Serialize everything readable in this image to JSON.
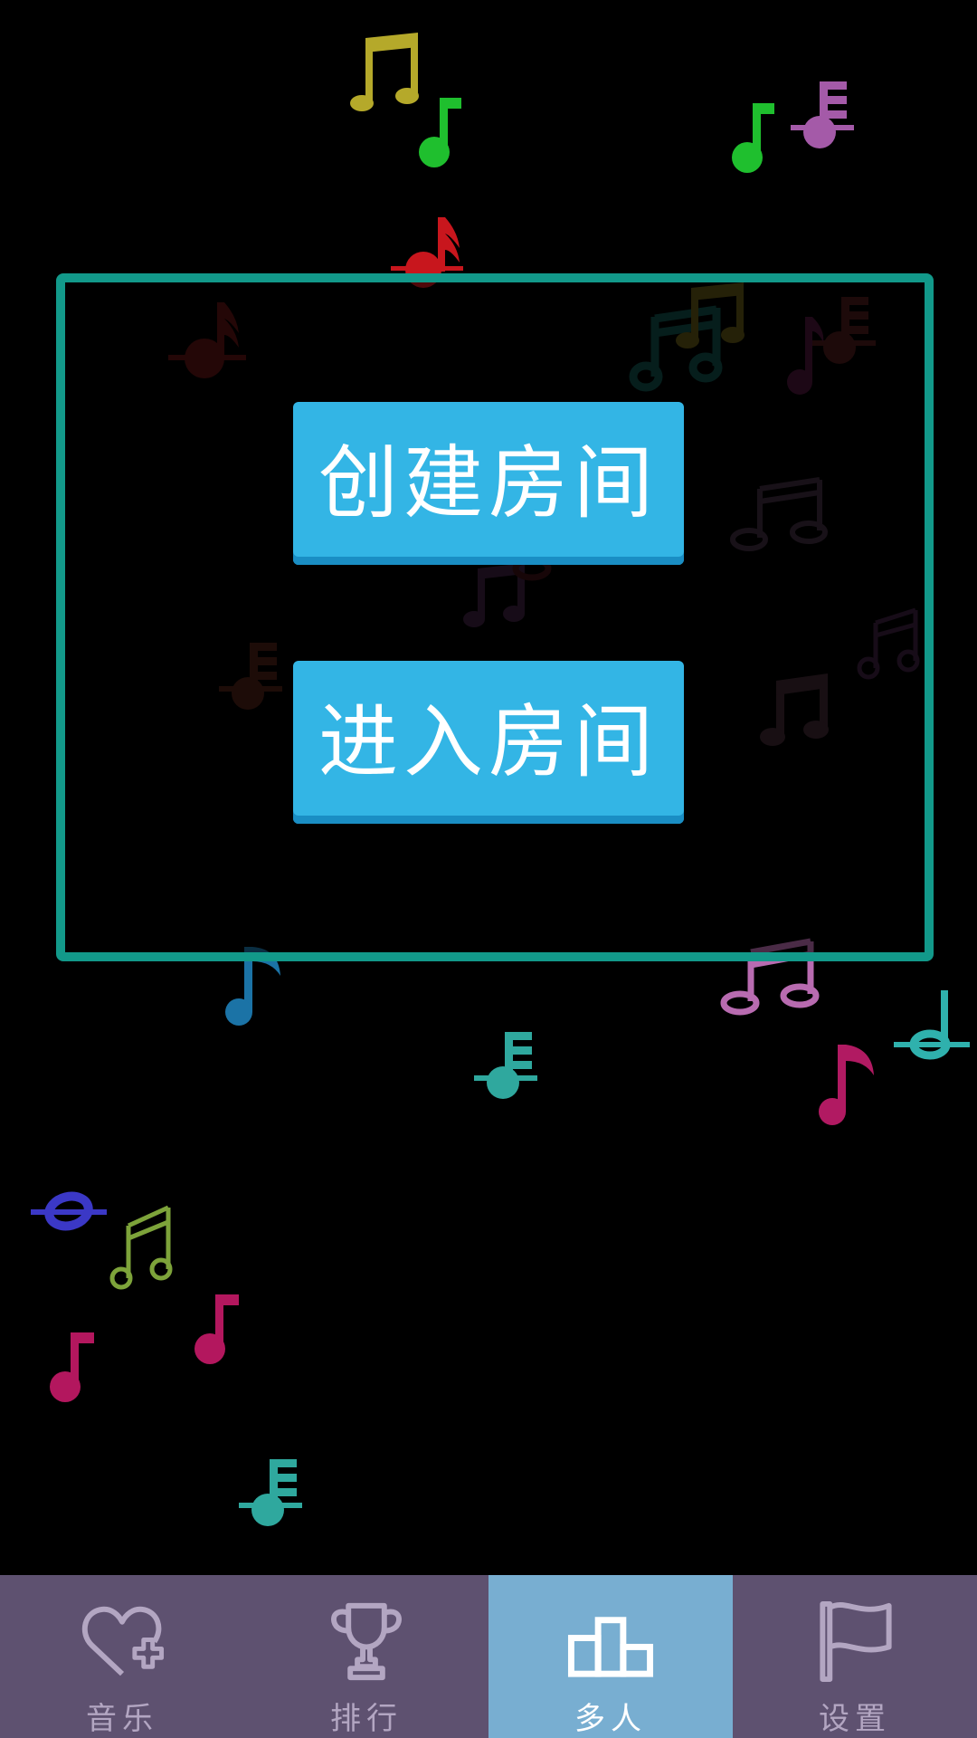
{
  "colors": {
    "background": "#000000",
    "dialog_border": "#12998a",
    "button_fill": "#33b5e5",
    "tabbar_bg": "#5e5170",
    "tab_active_bg": "#78aed1",
    "tab_inactive_text": "#b3a6c2",
    "tab_active_text": "#ffffff"
  },
  "dialog": {
    "create_room_label": "创建房间",
    "enter_room_label": "进入房间"
  },
  "tabbar": {
    "selected_tab": "多人",
    "tabs": [
      {
        "label": "音乐",
        "icon": "heart-plus-icon",
        "active": false
      },
      {
        "label": "排行",
        "icon": "trophy-icon",
        "active": false
      },
      {
        "label": "多人",
        "icon": "podium-icon",
        "active": true
      },
      {
        "label": "设置",
        "icon": "flag-icon",
        "active": false
      }
    ]
  },
  "background_notes": [
    {
      "icon": "beamed-eighth-notes-icon",
      "color": "#b5a92a"
    },
    {
      "icon": "eighth-note-icon",
      "color": "#1fbf2e"
    },
    {
      "icon": "eighth-note-icon",
      "color": "#1fbf2e"
    },
    {
      "icon": "thirty-second-note-icon",
      "color": "#a45aa8"
    },
    {
      "icon": "sixty-fourth-note-icon",
      "color": "#c8161d"
    },
    {
      "icon": "sixty-fourth-note-icon",
      "color": "#5a1212"
    },
    {
      "icon": "beamed-eighth-notes-icon",
      "color": "#0f4d48"
    },
    {
      "icon": "beamed-eighth-notes-icon",
      "color": "#5e5314"
    },
    {
      "icon": "thirty-second-note-icon",
      "color": "#4a1a1a"
    },
    {
      "icon": "eighth-note-icon",
      "color": "#4a1538"
    },
    {
      "icon": "beamed-eighth-notes-icon",
      "color": "#3d2b3d"
    },
    {
      "icon": "beamed-eighth-notes-icon",
      "color": "#3a1f3d"
    },
    {
      "icon": "beamed-eighth-notes-icon",
      "color": "#3a1f3d"
    },
    {
      "icon": "thirty-second-note-icon",
      "color": "#4a1f14"
    },
    {
      "icon": "beamed-eighth-notes-icon",
      "color": "#3d2631"
    },
    {
      "icon": "eighth-note-icon",
      "color": "#1b73a6"
    },
    {
      "icon": "beamed-eighth-notes-icon",
      "color": "#b86bb0"
    },
    {
      "icon": "thirty-second-note-icon",
      "color": "#2fa89e"
    },
    {
      "icon": "half-note-icon",
      "color": "#2fb1ad"
    },
    {
      "icon": "eighth-note-icon",
      "color": "#b11a62"
    },
    {
      "icon": "whole-note-icon",
      "color": "#3b38c6"
    },
    {
      "icon": "beamed-eighth-notes-icon",
      "color": "#7da33a"
    },
    {
      "icon": "eighth-note-icon",
      "color": "#b3175e"
    },
    {
      "icon": "eighth-note-icon",
      "color": "#b3175e"
    },
    {
      "icon": "thirty-second-note-icon",
      "color": "#2fa89e"
    }
  ]
}
